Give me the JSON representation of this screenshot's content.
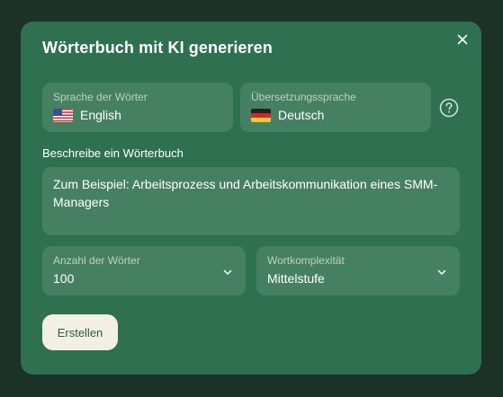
{
  "dialog": {
    "title": "Wörterbuch mit KI generieren"
  },
  "source_language": {
    "label": "Sprache der Wörter",
    "value": "English",
    "flag_icon": "us-flag-icon"
  },
  "target_language": {
    "label": "Übersetzungssprache",
    "value": "Deutsch",
    "flag_icon": "de-flag-icon"
  },
  "description": {
    "label": "Beschreibe ein Wörterbuch",
    "value": "Zum Beispiel: Arbeitsprozess und Arbeitskommunikation eines SMM-Managers"
  },
  "word_count": {
    "label": "Anzahl der Wörter",
    "value": "100"
  },
  "complexity": {
    "label": "Wortkomplexität",
    "value": "Mittelstufe"
  },
  "actions": {
    "create_label": "Erstellen"
  },
  "colors": {
    "backdrop": "#1c3226",
    "modal": "#2f7051",
    "field": "#468062",
    "button": "#f2f0e4"
  }
}
